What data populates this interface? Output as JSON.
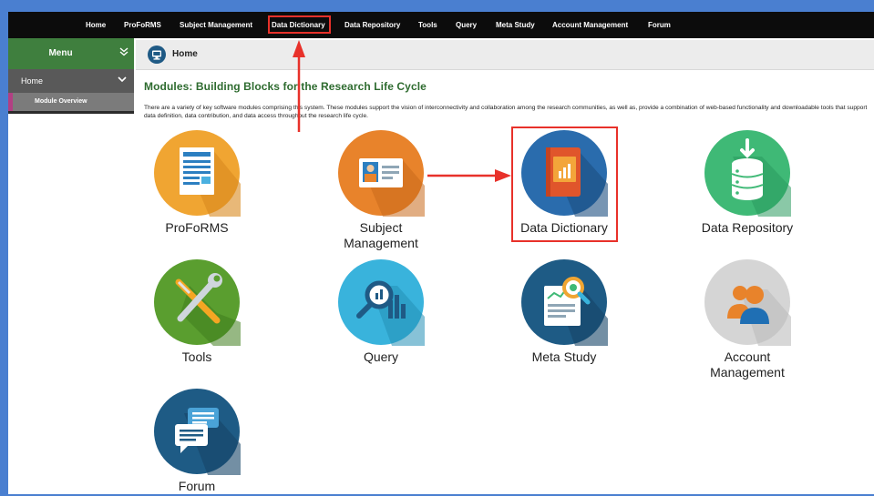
{
  "nav": {
    "items": [
      "Home",
      "ProFoRMS",
      "Subject Management",
      "Data Dictionary",
      "Data Repository",
      "Tools",
      "Query",
      "Meta Study",
      "Account Management",
      "Forum"
    ],
    "highlighted": "Data Dictionary"
  },
  "sidebar": {
    "title": "Menu",
    "collapse_icon": "double-chevron-down-icon",
    "home_label": "Home",
    "home_icon": "chevron-down-icon",
    "active_item": "Module Overview"
  },
  "breadcrumb": {
    "icon": "monitor-icon",
    "label": "Home"
  },
  "main": {
    "title": "Modules: Building Blocks for the Research Life Cycle",
    "description": "There are a variety of key software modules comprising this system. These modules support the vision of interconnectivity and collaboration among the research communities, as well as, provide a combination of web-based functionality and downloadable tools that support data definition, data contribution, and data access throughout the research life cycle."
  },
  "modules": [
    {
      "label": "ProFoRMS",
      "icon": "form-document-icon",
      "color": "#f0a532"
    },
    {
      "label": "Subject Management",
      "icon": "id-card-icon",
      "color": "#e8832b"
    },
    {
      "label": "Data Dictionary",
      "icon": "book-chart-icon",
      "color": "#2a6cad"
    },
    {
      "label": "Data Repository",
      "icon": "database-download-icon",
      "color": "#3fb976"
    },
    {
      "label": "Tools",
      "icon": "wrench-screwdriver-icon",
      "color": "#5a9e2f"
    },
    {
      "label": "Query",
      "icon": "magnifier-chart-icon",
      "color": "#39b3dc"
    },
    {
      "label": "Meta Study",
      "icon": "chart-magnifier-icon",
      "color": "#1e5b85"
    },
    {
      "label": "Account Management",
      "icon": "users-icon",
      "color": "#d5d5d5"
    },
    {
      "label": "Forum",
      "icon": "chat-bubbles-icon",
      "color": "#1e5b85"
    }
  ],
  "colors": {
    "nav_bg": "#0c0c0c",
    "menu_green": "#3f7f3e",
    "title_green": "#2e6b2f",
    "annotation_red": "#e8312a",
    "active_marker": "#b23f83"
  }
}
